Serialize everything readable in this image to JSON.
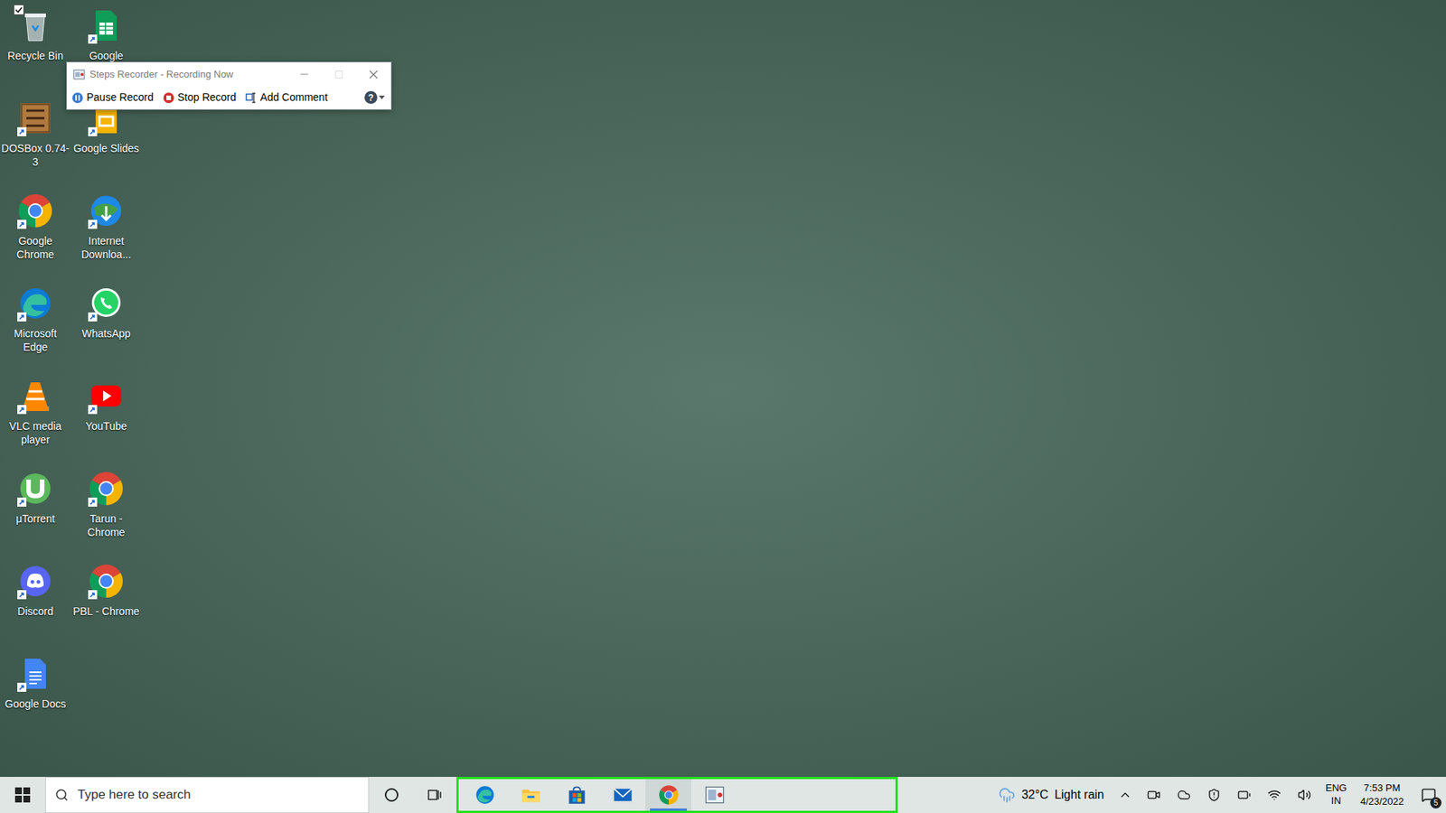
{
  "desktop": {
    "icons": [
      {
        "label": "Recycle Bin",
        "kind": "recycle",
        "checked": true
      },
      {
        "label": "Google",
        "kind": "sheets",
        "checked": false
      },
      {
        "label": "DOSBox 0.74-3",
        "kind": "dosbox",
        "checked": false
      },
      {
        "label": "Google Slides",
        "kind": "slides",
        "checked": false
      },
      {
        "label": "Google Chrome",
        "kind": "chrome",
        "checked": false
      },
      {
        "label": "Internet Downloa...",
        "kind": "idm",
        "checked": false
      },
      {
        "label": "Microsoft Edge",
        "kind": "edge",
        "checked": false
      },
      {
        "label": "WhatsApp",
        "kind": "whatsapp",
        "checked": false
      },
      {
        "label": "VLC media player",
        "kind": "vlc",
        "checked": false
      },
      {
        "label": "YouTube",
        "kind": "youtube",
        "checked": false
      },
      {
        "label": "μTorrent",
        "kind": "utorrent",
        "checked": false
      },
      {
        "label": "Tarun - Chrome",
        "kind": "chrome",
        "checked": false
      },
      {
        "label": "Discord",
        "kind": "discord",
        "checked": false
      },
      {
        "label": "PBL - Chrome",
        "kind": "chrome",
        "checked": false
      },
      {
        "label": "Google Docs",
        "kind": "docs",
        "checked": false
      }
    ]
  },
  "steps_recorder": {
    "title": "Steps Recorder - Recording Now",
    "buttons": [
      {
        "label": "Pause Record",
        "kind": "pause"
      },
      {
        "label": "Stop Record",
        "kind": "stop"
      },
      {
        "label": "Add Comment",
        "kind": "comment"
      }
    ],
    "help": "?"
  },
  "taskbar": {
    "search": {
      "placeholder": "Type here to search"
    },
    "apps": [
      {
        "kind": "edge",
        "selected": false
      },
      {
        "kind": "explorer",
        "selected": false
      },
      {
        "kind": "store",
        "selected": false
      },
      {
        "kind": "mail",
        "selected": false
      },
      {
        "kind": "chrome",
        "selected": true
      },
      {
        "kind": "steps",
        "selected": false
      }
    ],
    "weather": {
      "temperature": "32°C",
      "condition": "Light rain"
    },
    "tray": [
      {
        "kind": "meet"
      },
      {
        "kind": "onedrive"
      },
      {
        "kind": "security"
      },
      {
        "kind": "battery"
      },
      {
        "kind": "wifi"
      },
      {
        "kind": "volume"
      }
    ],
    "language": [
      "ENG",
      "IN"
    ],
    "time": "7:53 PM",
    "date": "4/23/2022",
    "notifications": "5"
  }
}
